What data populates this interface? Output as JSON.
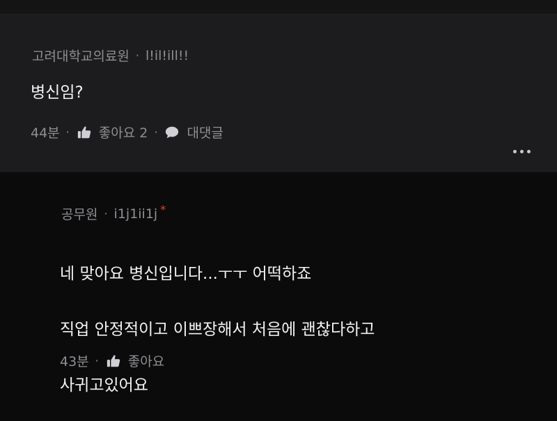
{
  "comment": {
    "author": "고려대학교의료원",
    "nickname": "l!il!ill!!",
    "body": "병신임?",
    "time": "44분",
    "like_label": "좋아요 2",
    "reply_label": "대댓글"
  },
  "reply": {
    "author": "공무원",
    "nickname": "i1j1ii1j",
    "author_mark": "*",
    "body_lines": [
      "네 맞아요 병신입니다...ㅜㅜ 어떡하죠",
      "직업 안정적이고 이쁘장해서 처음에 괜찮다하고",
      "사귀고있어요"
    ],
    "time": "43분",
    "like_label": "좋아요"
  },
  "separator": "·",
  "colors": {
    "comment_background": "#1c1c1e",
    "page_background": "#0b0b0c",
    "text_primary": "#f2f2f2",
    "text_secondary": "#8f8f93",
    "author_mark": "#e0443c"
  },
  "icons": {
    "like": "thumbs-up-icon",
    "reply": "speech-bubble-icon",
    "more": "more-options-icon"
  }
}
